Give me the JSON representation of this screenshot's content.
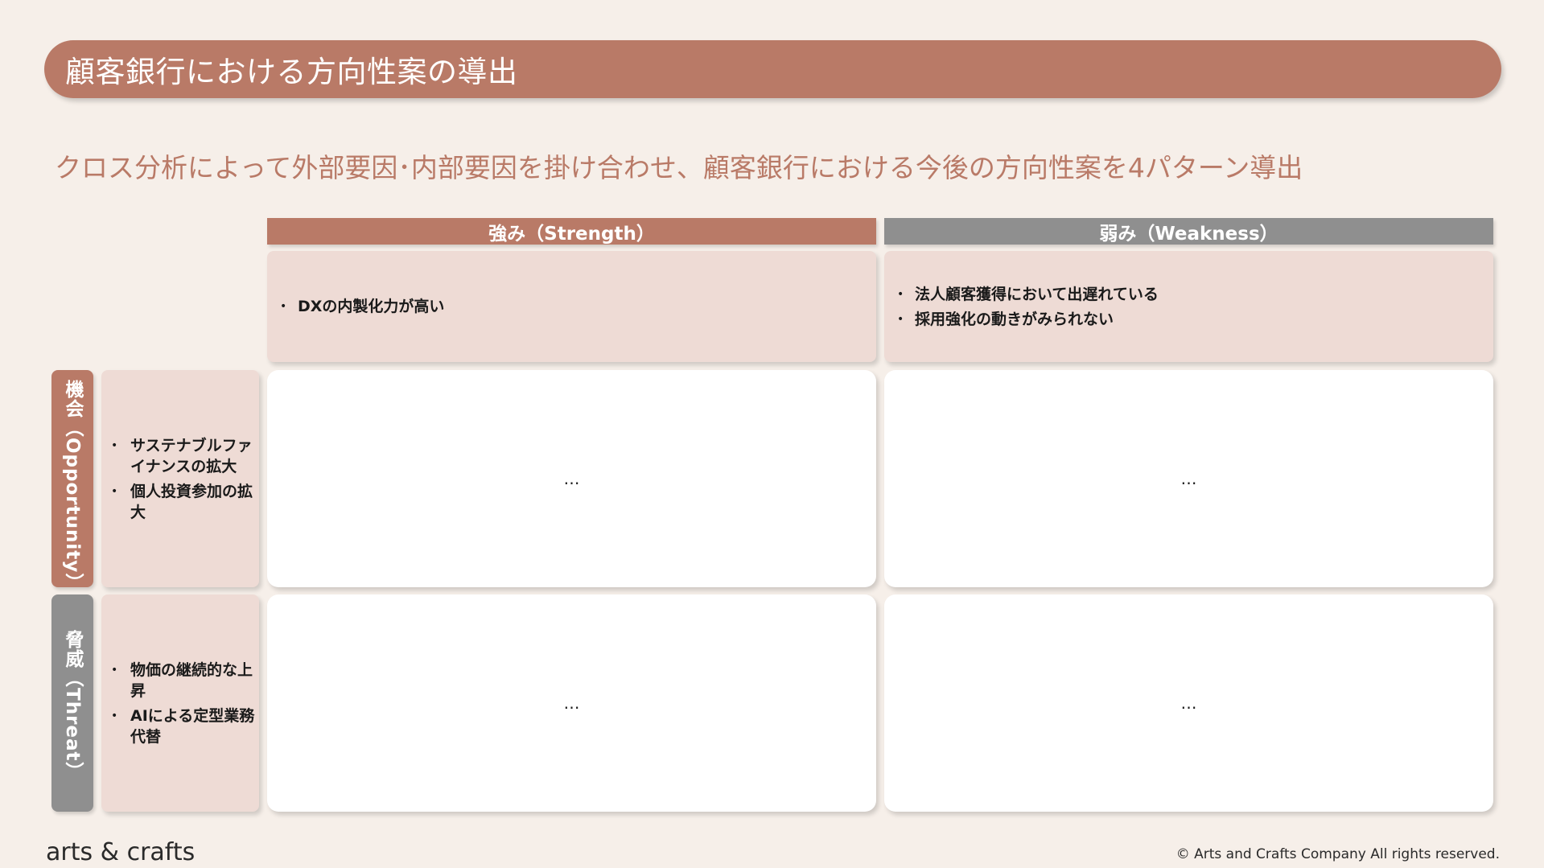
{
  "title": "顧客銀行における方向性案の導出",
  "subtitle": "クロス分析によって外部要因･内部要因を掛け合わせ、顧客銀行における今後の方向性案を4パターン導出",
  "columns": {
    "strength": {
      "label": "強み（Strength）",
      "items": [
        "DXの内製化力が高い"
      ]
    },
    "weakness": {
      "label": "弱み（Weakness）",
      "items": [
        "法人顧客獲得において出遅れている",
        "採用強化の動きがみられない"
      ]
    }
  },
  "rows": {
    "opportunity": {
      "label": "機会（Opportunity）",
      "items": [
        "サステナブルファイナンスの拡大",
        "個人投資参加の拡大"
      ]
    },
    "threat": {
      "label": "脅威（Threat）",
      "items": [
        "物価の継続的な上昇",
        "AIによる定型業務代替"
      ]
    }
  },
  "cells": {
    "so": "…",
    "wo": "…",
    "st": "…",
    "wt": "…"
  },
  "footer": {
    "logo": "arts & crafts",
    "copyright": "© Arts and Crafts Company All rights reserved."
  },
  "colors": {
    "accent": "#b97a67",
    "gray": "#8f8f8f",
    "pink": "#eedbd5",
    "background": "#f6efe9"
  }
}
